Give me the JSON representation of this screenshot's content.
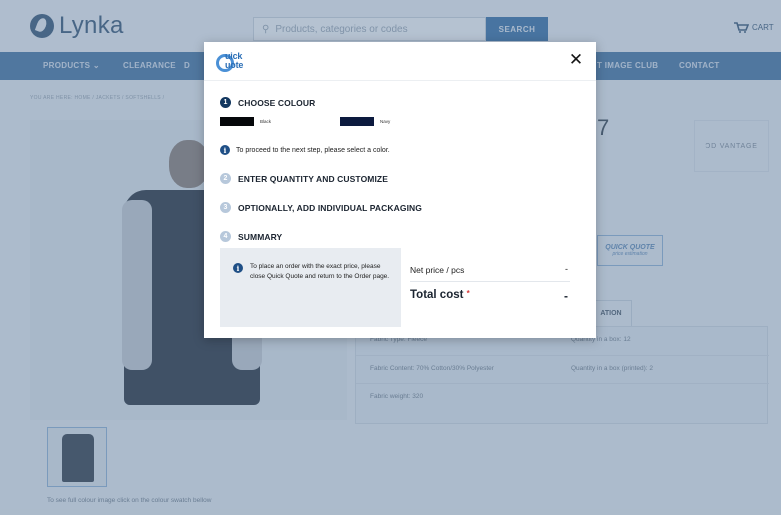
{
  "header": {
    "logo_text": "Lynka",
    "search_placeholder": "Products, categories or codes",
    "search_button": "SEARCH",
    "cart_label": "CART"
  },
  "nav": {
    "items": [
      "PRODUCTS ⌄",
      "CLEARANCE",
      "D",
      "T IMAGE CLUB",
      "CONTACT"
    ]
  },
  "breadcrumb": "YOU ARE HERE:  HOME  /  JACKETS / SOFTSHELLS  /",
  "product": {
    "title_fragment": "7",
    "brand_logo": "ƆD VANTAGE",
    "quick_quote_button": "QUICK QUOTE",
    "quick_quote_sub": "price estimation",
    "tab_fragment": "ATION",
    "thumb_hint": "To see full colour image click on the colour swatch bellow",
    "specs": [
      [
        "Fabric Type: Fleece",
        "Quantity in a box: 12"
      ],
      [
        "Fabric Content: 70% Cotton/30% Polyester",
        "Quantity in a box (printed): 2"
      ],
      [
        "Fabric weight: 320",
        ""
      ]
    ]
  },
  "modal": {
    "logo_text_line1": "uick",
    "logo_text_line2": "uote",
    "close_glyph": "✕",
    "steps": [
      {
        "num": "1",
        "label": "CHOOSE COLOUR"
      },
      {
        "num": "2",
        "label": "ENTER QUANTITY AND CUSTOMIZE"
      },
      {
        "num": "3",
        "label": "OPTIONALLY, ADD INDIVIDUAL PACKAGING"
      },
      {
        "num": "4",
        "label": "SUMMARY"
      }
    ],
    "colours": [
      {
        "name": "Black",
        "hex": "#05070a"
      },
      {
        "name": "Navy",
        "hex": "#0c1a3e"
      }
    ],
    "info_message": "To proceed to the next step, please select a color.",
    "summary": {
      "note": "To place an order with the exact price, please close Quick Quote and return to the Order page.",
      "net_price_label": "Net price / pcs",
      "net_price_value": "-",
      "total_label": "Total cost",
      "total_required_mark": "*",
      "total_value": "-"
    }
  },
  "colors": {
    "nav_blue": "#3f6fa0",
    "step_active": "#12375f",
    "step_inactive": "#b7c8db",
    "quick_quote_blue": "#4a90d6"
  }
}
